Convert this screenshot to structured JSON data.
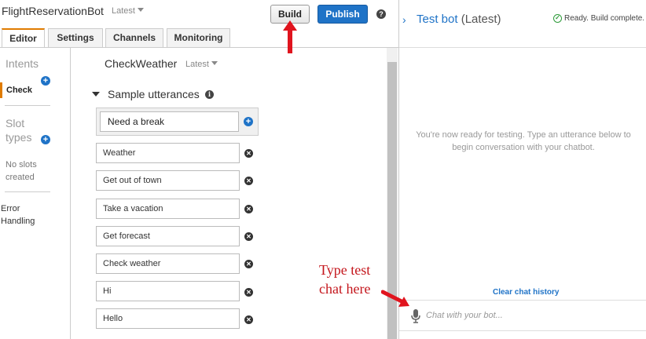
{
  "header": {
    "bot_name": "FlightReservationBot",
    "version": "Latest",
    "build_label": "Build",
    "publish_label": "Publish",
    "help_icon": "?"
  },
  "tabs": [
    "Editor",
    "Settings",
    "Channels",
    "Monitoring"
  ],
  "sidebar": {
    "intents_label": "Intents",
    "selected_intent": "Check",
    "slot_types_label": "Slot types",
    "no_slots": "No slots created",
    "error_handling": "Error Handling"
  },
  "intent": {
    "name": "CheckWeather",
    "version": "Latest"
  },
  "sample_utterances": {
    "header": "Sample utterances",
    "new_value": "Need a break",
    "items": [
      "Weather",
      "Get out of town",
      "Take a vacation",
      "Get forecast",
      "Check weather",
      "Hi",
      "Hello"
    ]
  },
  "test_bot": {
    "title": "Test bot",
    "version": "(Latest)",
    "status": "Ready. Build complete.",
    "ready_message": "You're now ready for testing. Type an utterance below to begin conversation with your chatbot.",
    "clear_history": "Clear chat history",
    "chat_placeholder": "Chat with your bot..."
  },
  "annotation": {
    "text": "Type test chat here",
    "color": "#c4161c"
  },
  "colors": {
    "accent": "#1f73c7",
    "tab_active": "#e07b00",
    "status_ok": "#2e9b3a"
  }
}
